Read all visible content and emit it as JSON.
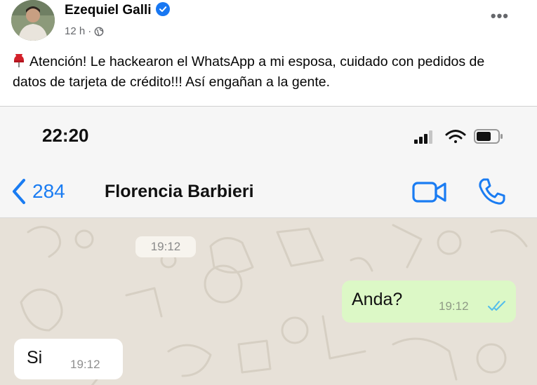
{
  "post": {
    "author": "Ezequiel Galli",
    "time": "12 h",
    "separator": "·",
    "text": "Atención! Le hackearon el WhatsApp a mi esposa, cuidado con pedidos de datos de tarjeta de crédito!!! Así engañan a la gente.",
    "more_label": "•••"
  },
  "screenshot": {
    "status_time": "22:20",
    "back_count": "284",
    "contact_name": "Florencia Barbieri",
    "date_pill": "19:12",
    "messages": [
      {
        "direction": "outgoing",
        "text": "Anda?",
        "time": "19:12",
        "read": true
      },
      {
        "direction": "incoming",
        "text": "Si",
        "time": "19:12"
      }
    ]
  },
  "colors": {
    "facebook_blue": "#1877f2",
    "whatsapp_blue": "#1a7cf2",
    "outgoing_bubble": "#dcf8c6",
    "chat_background": "#e7e1d8",
    "read_ticks": "#53bdeb"
  },
  "icons": [
    "verified-badge-icon",
    "globe-icon",
    "more-icon",
    "pushpin-emoji-icon",
    "signal-icon",
    "wifi-icon",
    "battery-icon",
    "back-chevron-icon",
    "video-call-icon",
    "phone-icon",
    "double-check-icon"
  ]
}
